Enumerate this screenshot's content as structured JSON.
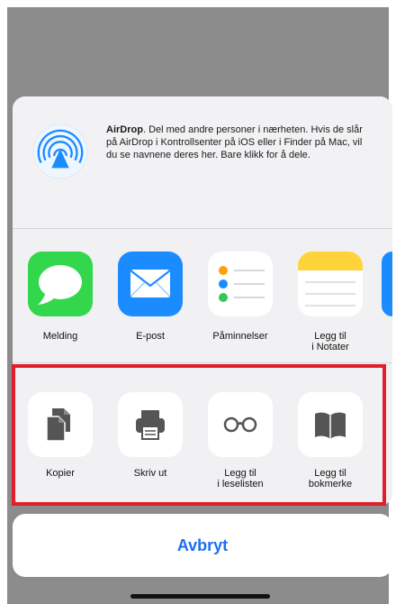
{
  "colors": {
    "overlay": "#8c8c8c",
    "sheet": "#f1f1f3",
    "highlight": "#e01f2d",
    "cancel_text": "#1c6ff2",
    "messages": "#32d74b",
    "mail": "#1a8cff",
    "notes": "#ffd43b"
  },
  "airdrop": {
    "icon_name": "airdrop-icon",
    "title": "AirDrop",
    "description": ". Del med andre personer i nærheten. Hvis de slår på AirDrop i Kontrollsenter på iOS eller i Finder på Mac, vil du se navnene deres her. Bare klikk for å dele."
  },
  "apps": [
    {
      "label": "Melding",
      "icon": "messages-icon"
    },
    {
      "label": "E-post",
      "icon": "mail-icon"
    },
    {
      "label": "Påminnelser",
      "icon": "reminders-icon"
    },
    {
      "label": "Legg til\ni Notater",
      "icon": "notes-icon"
    }
  ],
  "actions": [
    {
      "label": "Kopier",
      "icon": "copy-icon"
    },
    {
      "label": "Skriv ut",
      "icon": "print-icon"
    },
    {
      "label": "Legg til\ni leselisten",
      "icon": "reading-list-icon"
    },
    {
      "label": "Legg til\nbokmerke",
      "icon": "bookmark-icon"
    }
  ],
  "cancel": {
    "label": "Avbryt"
  }
}
